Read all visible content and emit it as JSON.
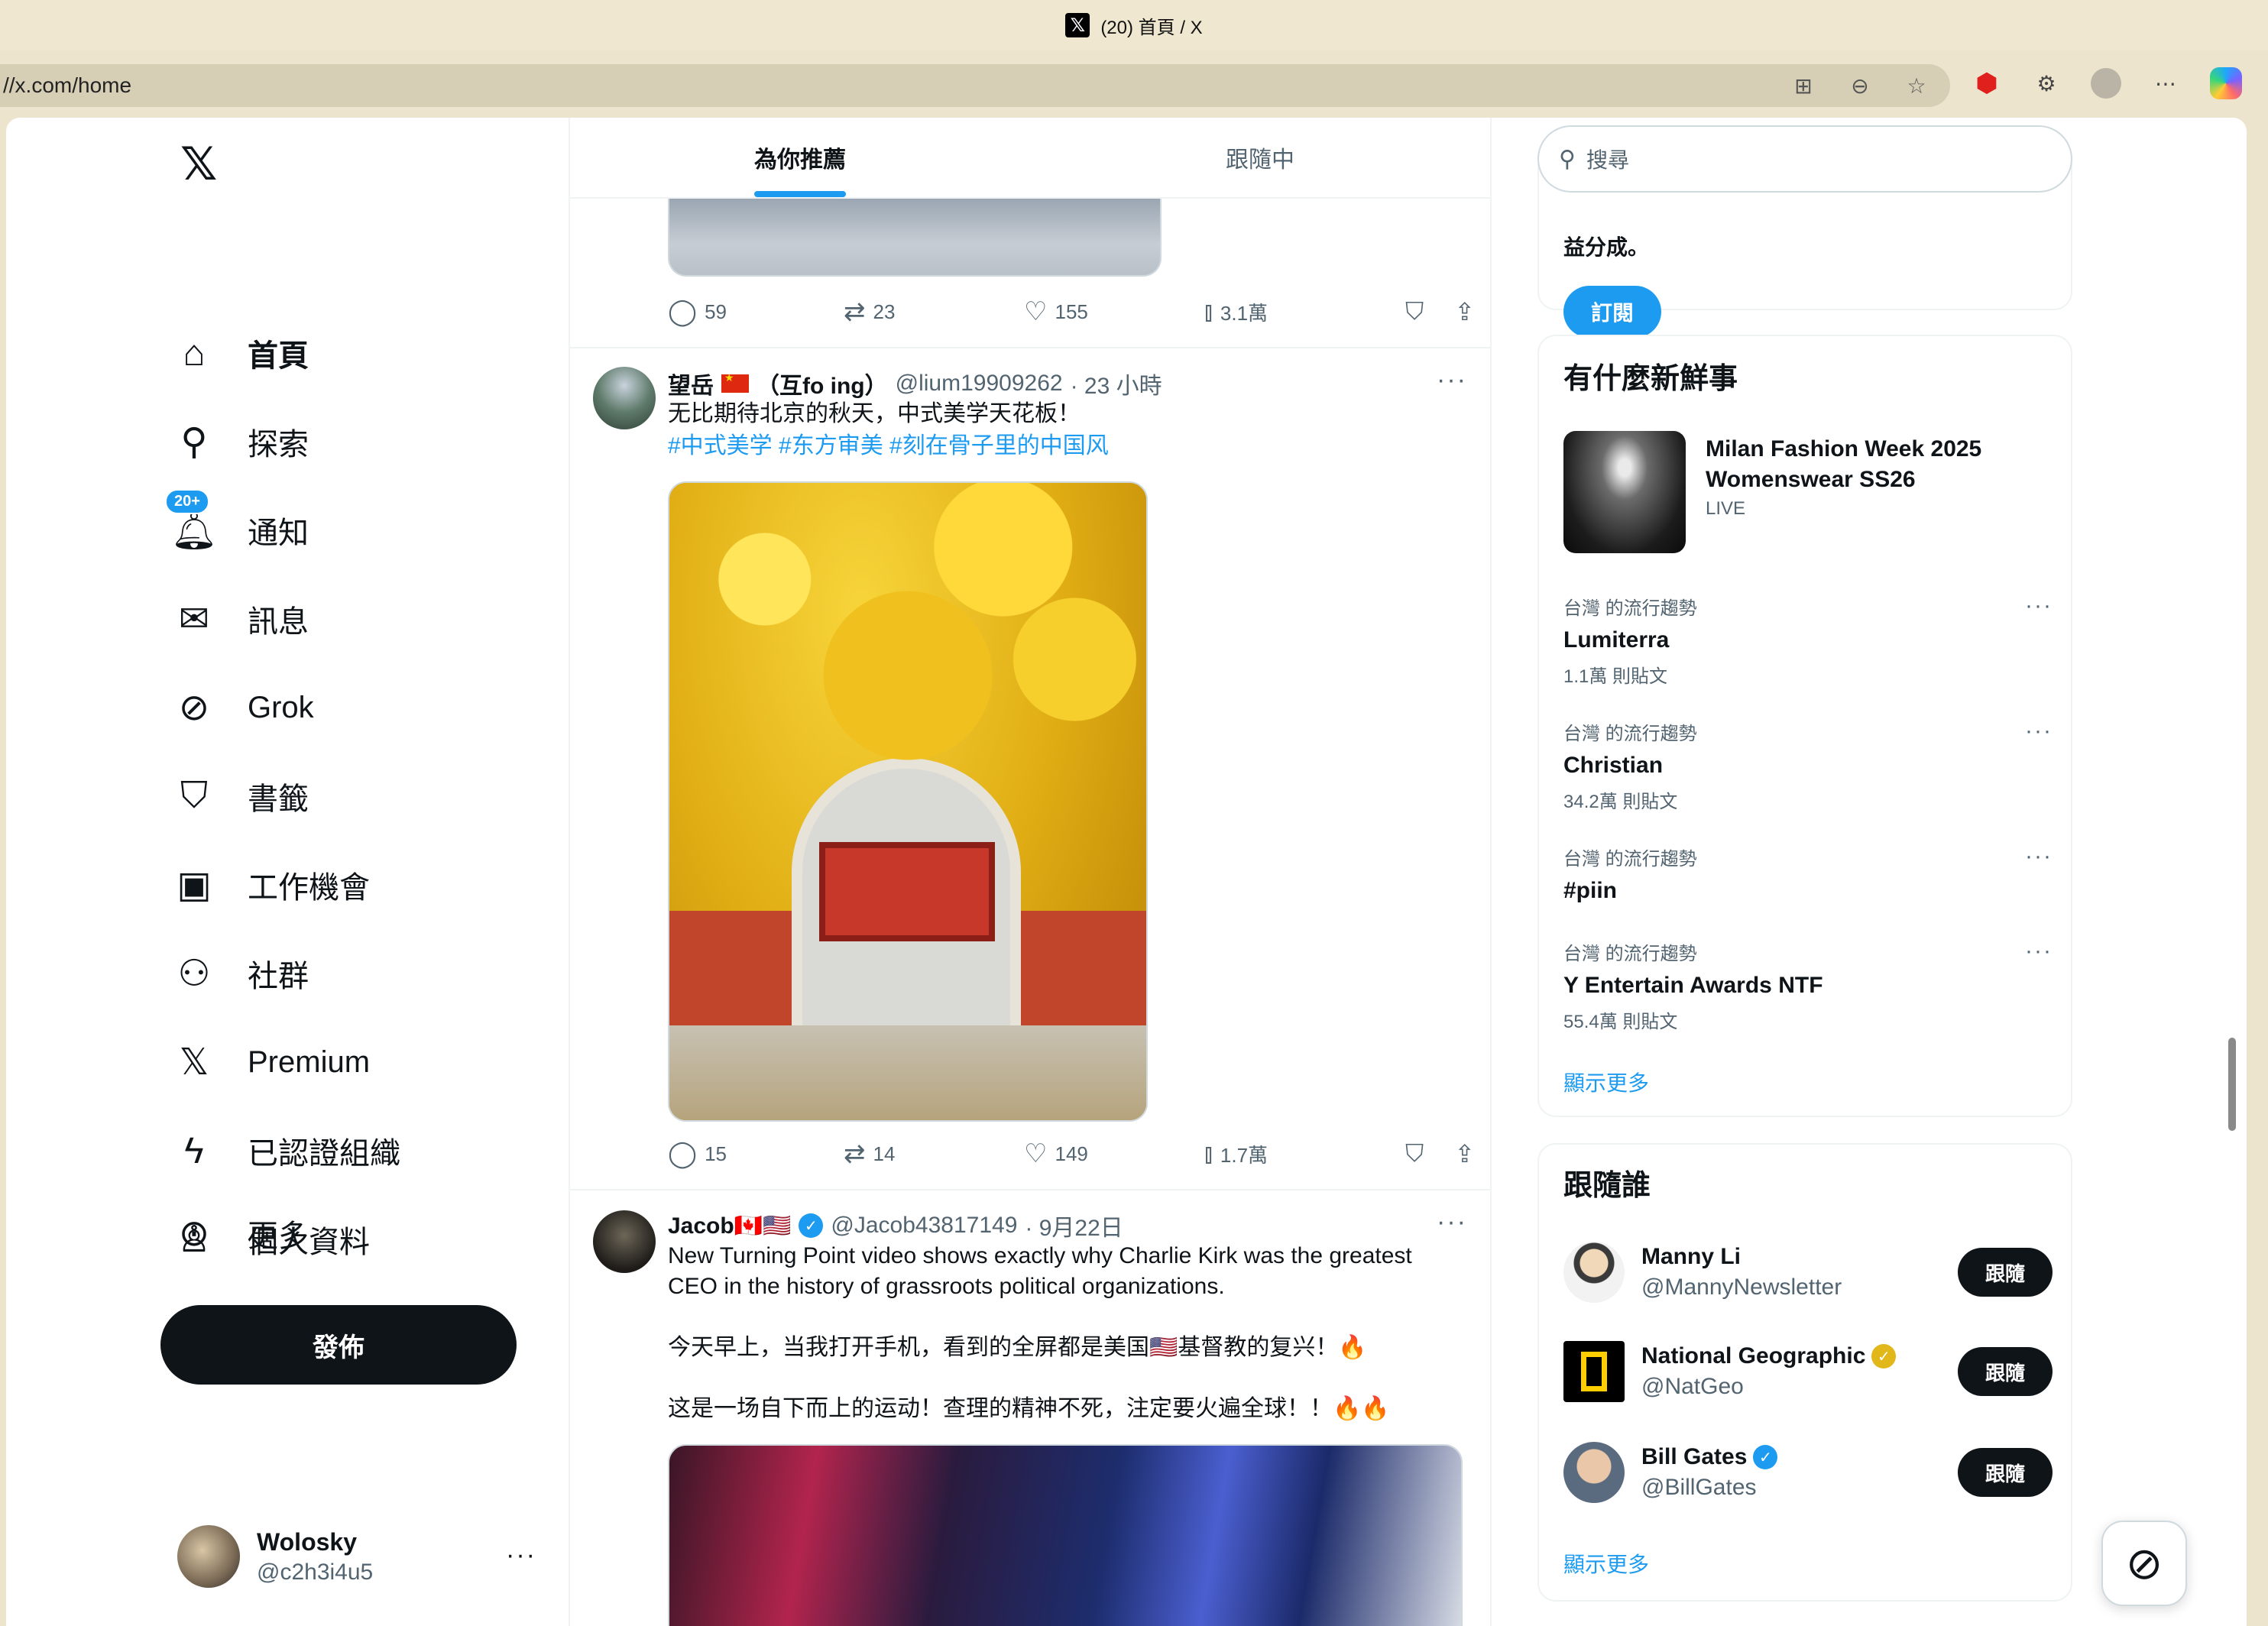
{
  "browser": {
    "tab_title": "(20) 首頁 / X",
    "url": "//x.com/home"
  },
  "nav": {
    "logo": "𝕏",
    "items": [
      {
        "label": "首頁",
        "icon": "home-icon",
        "glyph": "⌂"
      },
      {
        "label": "探索",
        "icon": "search-icon",
        "glyph": "⚲"
      },
      {
        "label": "通知",
        "icon": "bell-icon",
        "glyph": "🔔︎",
        "badge": "20+"
      },
      {
        "label": "訊息",
        "icon": "mail-icon",
        "glyph": "✉"
      },
      {
        "label": "Grok",
        "icon": "grok-icon",
        "glyph": "⊘"
      },
      {
        "label": "書籤",
        "icon": "bookmark-icon",
        "glyph": "⛉"
      },
      {
        "label": "工作機會",
        "icon": "briefcase-icon",
        "glyph": "▣"
      },
      {
        "label": "社群",
        "icon": "communities-icon",
        "glyph": "⚇"
      },
      {
        "label": "Premium",
        "icon": "x-premium-icon",
        "glyph": "𝕏"
      },
      {
        "label": "已認證組織",
        "icon": "lightning-icon",
        "glyph": "ϟ"
      },
      {
        "label": "個人資料",
        "icon": "profile-icon",
        "glyph": "♙"
      },
      {
        "label": "更多",
        "icon": "more-circle-icon",
        "glyph": "⊙"
      }
    ],
    "post_button": "發佈",
    "account": {
      "name": "Wolosky",
      "handle": "@c2h3i4u5"
    }
  },
  "feed": {
    "tabs": [
      "為你推薦",
      "跟隨中"
    ],
    "prev_tweet": {
      "replies": "59",
      "retweets": "23",
      "likes": "155",
      "views": "3.1萬"
    },
    "tweet1": {
      "name": "望岳",
      "name_suffix": "（互fo ing）",
      "handle": "@lium19909262",
      "time": "· 23 小時",
      "text": "无比期待北京的秋天，中式美学天花板！",
      "hashtags": "#中式美学 #东方审美 #刻在骨子里的中国风",
      "replies": "15",
      "retweets": "14",
      "likes": "149",
      "views": "1.7萬"
    },
    "tweet2": {
      "name": "Jacob🇨🇦🇺🇸",
      "handle": "@Jacob43817149",
      "time": "· 9月22日",
      "text1": "New Turning Point video shows exactly why Charlie Kirk was the greatest CEO in the history of grassroots political organizations.",
      "text2": "今天早上，当我打开手机，看到的全屏都是美国🇺🇸基督教的复兴！🔥",
      "text3": "这是一场自下而上的运动！查理的精神不死，注定要火遍全球！！🔥🔥"
    }
  },
  "sidebar": {
    "search_placeholder": "搜尋",
    "premium_text": "益分成。",
    "subscribe": "訂閱",
    "trends_title": "有什麼新鮮事",
    "live": {
      "title": "Milan Fashion Week 2025 Womenswear SS26",
      "tag": "LIVE"
    },
    "trends": [
      {
        "context": "台灣 的流行趨勢",
        "name": "Lumiterra",
        "count": "1.1萬 則貼文"
      },
      {
        "context": "台灣 的流行趨勢",
        "name": "Christian",
        "count": "34.2萬 則貼文"
      },
      {
        "context": "台灣 的流行趨勢",
        "name": "#piin",
        "count": ""
      },
      {
        "context": "台灣 的流行趨勢",
        "name": "Y Entertain Awards NTF",
        "count": "55.4萬 則貼文"
      }
    ],
    "show_more": "顯示更多",
    "follow_title": "跟隨誰",
    "follow": [
      {
        "name": "Manny Li",
        "handle": "@MannyNewsletter",
        "verified": "",
        "button": "跟隨"
      },
      {
        "name": "National Geographic",
        "handle": "@NatGeo",
        "verified": "gold",
        "button": "跟隨"
      },
      {
        "name": "Bill Gates",
        "handle": "@BillGates",
        "verified": "blue",
        "button": "跟隨"
      }
    ],
    "follow_show_more": "顯示更多"
  },
  "colors": {
    "accent": "#1d9bf0",
    "text": "#0f1419",
    "muted": "#536471"
  }
}
